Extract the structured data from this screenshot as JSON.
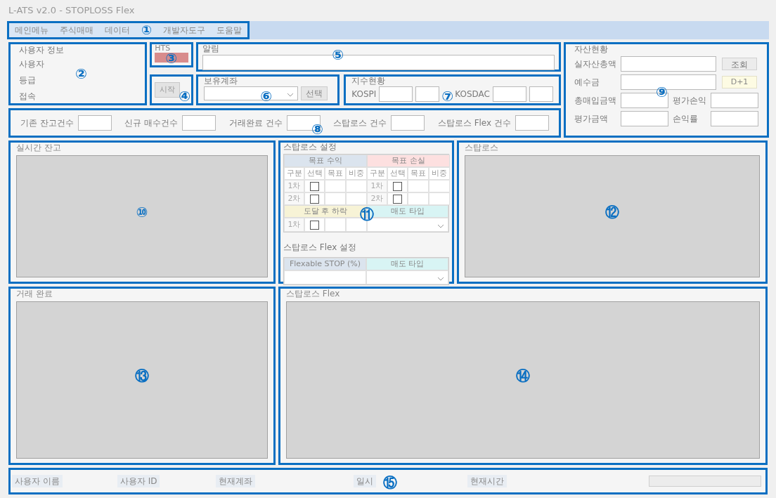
{
  "window": {
    "title": "L-ATS v2.0 - STOPLOSS Flex"
  },
  "menu": {
    "items": [
      "메인메뉴",
      "주식매매",
      "데이터",
      "개발자도구",
      "도움말"
    ],
    "callout": "①"
  },
  "user_info": {
    "title": "사용자 정보",
    "labels": [
      "사용자",
      "등급",
      "접속"
    ],
    "callout": "②"
  },
  "hts": {
    "label": "HTS",
    "connected": false,
    "callout": "③"
  },
  "start": {
    "button": "시작",
    "callout": "④"
  },
  "alert": {
    "title": "알림",
    "callout": "⑤"
  },
  "account": {
    "title": "보유계좌",
    "button": "선택",
    "callout": "⑥"
  },
  "index": {
    "title": "지수현황",
    "labels": [
      "KOSPI",
      "KOSDAC"
    ],
    "callout": "⑦"
  },
  "counts": {
    "labels": [
      "기존 잔고건수",
      "신규 매수건수",
      "거래완료 건수",
      "스탑로스 건수",
      "스탑로스 Flex 건수"
    ],
    "callout": "⑧"
  },
  "assets": {
    "title": "자산현황",
    "labels": [
      "실자산총액",
      "예수금",
      "총매입금액",
      "평가손익",
      "평가금액",
      "손익률"
    ],
    "query_button": "조회",
    "settle_badge": "D+1",
    "callout": "⑨"
  },
  "realtime_balance": {
    "title": "실시간 잔고",
    "callout": "⑩"
  },
  "stoploss_settings": {
    "title": "스탑로스 설정",
    "callout": "⑪",
    "profit": {
      "title": "목표 수익",
      "columns": [
        "구분",
        "선택",
        "목표",
        "비중"
      ],
      "rows": [
        {
          "label": "1차",
          "checked": false
        },
        {
          "label": "2차",
          "checked": false
        }
      ]
    },
    "loss": {
      "title": "목표 손실",
      "columns": [
        "구분",
        "선택",
        "목표",
        "비중"
      ],
      "rows": [
        {
          "label": "1차",
          "checked": false
        },
        {
          "label": "2차",
          "checked": false
        }
      ]
    },
    "drop": {
      "title": "도달 후 하락",
      "rows": [
        {
          "label": "1차",
          "checked": false
        }
      ]
    },
    "sell_type": {
      "title": "매도 타입"
    }
  },
  "flex_settings": {
    "title": "스탑로스 Flex 설정",
    "columns": [
      "Flexable STOP (%)",
      "매도 타입"
    ]
  },
  "stoploss": {
    "title": "스탑로스",
    "callout": "⑫"
  },
  "completed": {
    "title": "거래 완료",
    "callout": "⑬"
  },
  "stoploss_flex": {
    "title": "스탑로스 Flex",
    "callout": "⑭"
  },
  "status_bar": {
    "items": [
      "사용자 이름",
      "사용자 ID",
      "현재계좌",
      "일시",
      "현재시간"
    ],
    "progress": {
      "level": 0
    },
    "callout": "⑮"
  }
}
